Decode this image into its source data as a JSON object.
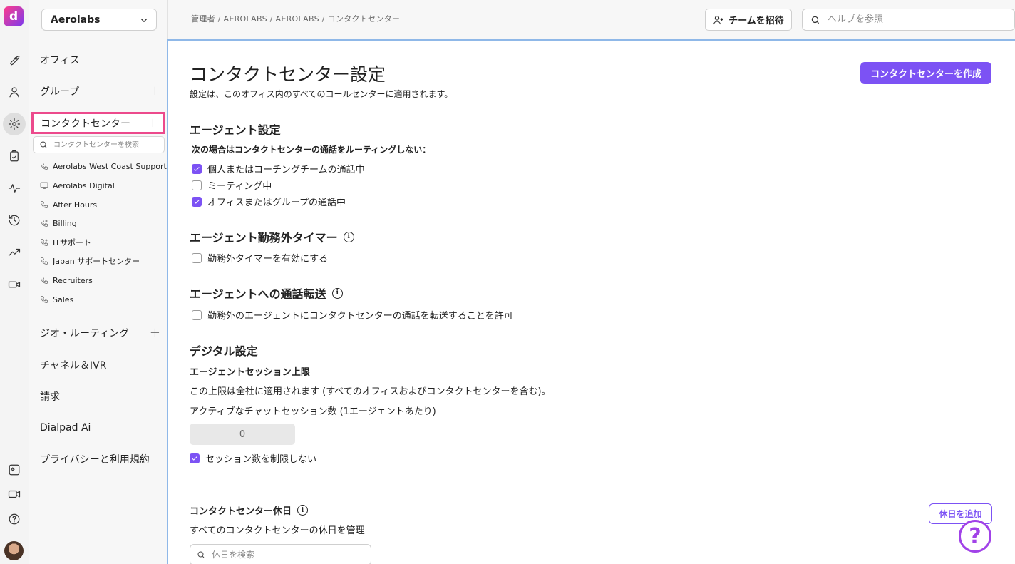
{
  "app": {
    "logo_letter": "d",
    "org_name": "Aerolabs"
  },
  "rail": {
    "icons": [
      "rocket-icon",
      "person-icon",
      "gear-icon",
      "clipboard-icon",
      "pulse-icon",
      "history-icon",
      "trend-icon",
      "video-camera-icon",
      "dialpad-ai-icon",
      "meeting-video-icon",
      "help-circle-icon",
      "user-avatar"
    ]
  },
  "sidebar": {
    "items": {
      "office": "オフィス",
      "groups": "グループ",
      "contact_center": "コンタクトセンター",
      "geo_routing": "ジオ・ルーティング",
      "channels_ivr": "チャネル＆IVR",
      "billing": "請求",
      "dialpad_ai": "Dialpad Ai",
      "privacy": "プライバシーと利用規約"
    },
    "plus": "+",
    "cc_search_placeholder": "コンタクトセンターを検索",
    "contact_centers": [
      {
        "name": "Aerolabs West Coast Support",
        "icon": "phone-icon"
      },
      {
        "name": "Aerolabs Digital",
        "icon": "monitor-icon"
      },
      {
        "name": "After Hours",
        "icon": "phone-icon"
      },
      {
        "name": "Billing",
        "icon": "phone-cog-icon"
      },
      {
        "name": "ITサポート",
        "icon": "phone-cog-icon"
      },
      {
        "name": "Japan サポートセンター",
        "icon": "phone-icon"
      },
      {
        "name": "Recruiters",
        "icon": "phone-icon"
      },
      {
        "name": "Sales",
        "icon": "phone-icon"
      }
    ]
  },
  "topbar": {
    "breadcrumb": "管理者 / AEROLABS / AEROLABS / コンタクトセンター",
    "invite_label": "チームを招待",
    "help_placeholder": "ヘルプを参照"
  },
  "main": {
    "title": "コンタクトセンター設定",
    "subtitle": "設定は、このオフィス内のすべてのコールセンターに適用されます。",
    "create_label": "コンタクトセンターを作成",
    "agent_settings": {
      "heading": "エージェント設定",
      "label": "次の場合はコンタクトセンターの通話をルーティングしない：",
      "options": [
        {
          "label": "個人またはコーチングチームの通話中",
          "checked": true
        },
        {
          "label": "ミーティング中",
          "checked": false
        },
        {
          "label": "オフィスまたはグループの通話中",
          "checked": true
        }
      ]
    },
    "off_duty_timer": {
      "heading": "エージェント勤務外タイマー",
      "option": "勤務外タイマーを有効にする"
    },
    "call_transfer": {
      "heading": "エージェントへの通話転送",
      "option": "勤務外のエージェントにコンタクトセンターの通話を転送することを許可"
    },
    "digital": {
      "heading": "デジタル設定",
      "session_limit_label": "エージェントセッション上限",
      "session_limit_desc": "この上限は全社に適用されます (すべてのオフィスおよびコンタクトセンターを含む)。",
      "active_sessions_label": "アクティブなチャットセッション数 (1エージェントあたり)",
      "active_sessions_value": "0",
      "unlimited_label": "セッション数を制限しない",
      "unlimited_checked": true
    },
    "holidays": {
      "heading": "コンタクトセンター休日",
      "desc": "すべてのコンタクトセンターの休日を管理",
      "add_label": "休日を追加",
      "search_placeholder": "休日を検索"
    },
    "help_fab": "?"
  },
  "colors": {
    "accent": "#7c52f4",
    "highlight": "#ec4a8c",
    "help_fab": "#a142e8"
  }
}
